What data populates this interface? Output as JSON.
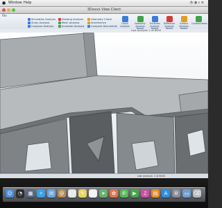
{
  "menubar": {
    "window": "Window",
    "help": "Help"
  },
  "window": {
    "title": "3Dxxxx View Client"
  },
  "ribbon": {
    "tab": "File",
    "small_buttons": [
      {
        "label": "Simulation Analysis",
        "icon": "analysis-icon",
        "color": "#3c7bd8"
      },
      {
        "label": "Study Analysis",
        "icon": "study-icon",
        "color": "#3c7bd8"
      },
      {
        "label": "Compare Analysis",
        "icon": "compare-icon",
        "color": "#3c7bd8"
      },
      {
        "label": "Drawing Analysis",
        "icon": "drawing-icon",
        "color": "#cf3d3d"
      },
      {
        "label": "Mesh Analysis",
        "icon": "mesh-icon",
        "color": "#3fa24b"
      },
      {
        "label": "Annotate Analysis",
        "icon": "annotate-icon",
        "color": "#3fa24b"
      },
      {
        "label": "Geometry Check",
        "icon": "geometry-icon",
        "color": "#e39b25"
      },
      {
        "label": "Interference",
        "icon": "interference-icon",
        "color": "#e39b25"
      },
      {
        "label": "Compare Documents",
        "icon": "documents-icon",
        "color": "#3c7bd8"
      }
    ],
    "big_buttons": [
      {
        "label": "Check Analysis",
        "icon": "check-icon",
        "color": "#3c7bd8"
      },
      {
        "label": "Geometry Analysis Report",
        "icon": "report-icon",
        "color": "#3fa24b"
      },
      {
        "label": "Thickness Analysis Report",
        "icon": "thickness-icon",
        "color": "#3c7bd8"
      },
      {
        "label": "Difference Analysis Report",
        "icon": "difference-icon",
        "color": "#cf3d3d"
      },
      {
        "label": "Surface Analysis Report",
        "icon": "surface-icon",
        "color": "#e39b25"
      },
      {
        "label": "Customization",
        "icon": "customize-icon",
        "color": "#3fa24b"
      }
    ]
  },
  "strip": {
    "breadcrumb": "Last Analysis: 1 of 8000"
  },
  "status": {
    "text": "Last analysis: 1 of 8000"
  },
  "colors": {
    "part_light": "#9ea2a5",
    "part_mid": "#7d8185",
    "part_dark": "#56595c",
    "ribbon_text": "#1e3a66"
  },
  "dock": [
    {
      "name": "finder-icon",
      "color": "#4a8fdc",
      "glyph": "☺"
    },
    {
      "name": "dashboard-icon",
      "color": "#2d2d2d",
      "glyph": "◔"
    },
    {
      "name": "mission-control-icon",
      "color": "#5a6b84",
      "glyph": "▦"
    },
    {
      "name": "safari-icon",
      "color": "#3aa0e6",
      "glyph": "✧"
    },
    {
      "name": "mail-icon",
      "color": "#6fa7d8",
      "glyph": "✉"
    },
    {
      "name": "contacts-icon",
      "color": "#b58d54",
      "glyph": "@"
    },
    {
      "name": "calendar-icon",
      "color": "#e6e6e6",
      "glyph": "17"
    },
    {
      "name": "notes-icon",
      "color": "#e9d36a",
      "glyph": "✎"
    },
    {
      "name": "reminders-icon",
      "color": "#f0f0f0",
      "glyph": "☑"
    },
    {
      "name": "maps-icon",
      "color": "#64b36c",
      "glyph": "➤"
    },
    {
      "name": "photos-icon",
      "color": "#e7734a",
      "glyph": "✿"
    },
    {
      "name": "messages-icon",
      "color": "#58b857",
      "glyph": "✆"
    },
    {
      "name": "facetime-icon",
      "color": "#45a74a",
      "glyph": "▶"
    },
    {
      "name": "itunes-icon",
      "color": "#d04ea0",
      "glyph": "♫"
    },
    {
      "name": "ibooks-icon",
      "color": "#e58f2e",
      "glyph": "▤"
    },
    {
      "name": "app-store-icon",
      "color": "#2f8fe0",
      "glyph": "A"
    },
    {
      "name": "system-preferences-icon",
      "color": "#8b8f95",
      "glyph": "⚙"
    },
    {
      "name": "folder-icon",
      "color": "#6e9fd6",
      "glyph": "▭"
    },
    {
      "name": "trash-icon",
      "color": "#b8bcc2",
      "glyph": "⌫"
    }
  ]
}
